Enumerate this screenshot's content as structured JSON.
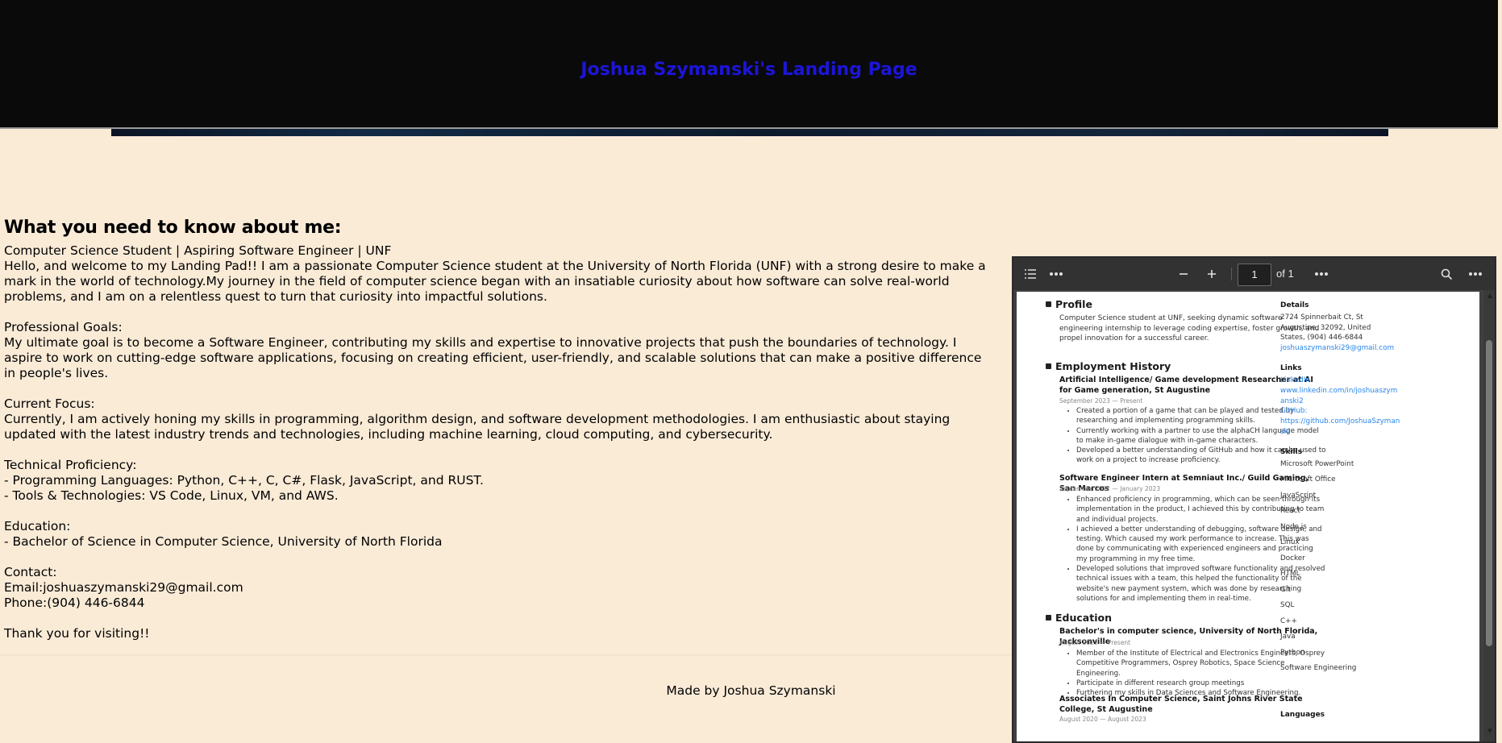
{
  "header": {
    "title": "Joshua Szymanski's Landing Page"
  },
  "about": {
    "heading": "What you need to know about me:",
    "subtitle": "Computer Science Student | Aspiring Software Engineer | UNF",
    "intro": "Hello, and welcome to my Landing Pad!! I am a passionate Computer Science student at the University of North Florida (UNF) with a strong desire to make a mark in the world of technology.My journey in the field of computer science began with an insatiable curiosity about how software can solve real-world problems, and I am on a relentless quest to turn that curiosity into impactful solutions.",
    "goals_label": "Professional Goals:",
    "goals": "My ultimate goal is to become a Software Engineer, contributing my skills and expertise to innovative projects that push the boundaries of technology. I aspire to work on cutting-edge software applications, focusing on creating efficient, user-friendly, and scalable solutions that can make a positive difference in people's lives.",
    "focus_label": "Current Focus:",
    "focus": "Currently, I am actively honing my skills in programming, algorithm design, and software development methodologies. I am enthusiastic about staying updated with the latest industry trends and technologies, including machine learning, cloud computing, and cybersecurity.",
    "tech_label": "Technical Proficiency:",
    "tech_lang": "- Programming Languages: Python, C++, C, C#, Flask, JavaScript, and RUST.",
    "tech_tools": "- Tools & Technologies: VS Code, Linux, VM, and AWS.",
    "edu_label": "Education:",
    "edu": "- Bachelor of Science in Computer Science, University of North Florida",
    "contact_label": "Contact:",
    "email": "Email:joshuaszymanski29@gmail.com",
    "phone": "Phone:(904) 446-6844",
    "thanks": "Thank you for visiting!!"
  },
  "footer": {
    "text": "Made by Joshua Szymanski"
  },
  "pdf": {
    "page_value": "1",
    "page_of": "of 1",
    "icons": [
      "outline-icon",
      "more-icon",
      "zoom-out-icon",
      "zoom-in-icon",
      "more-icon",
      "search-icon",
      "more-icon"
    ],
    "profile": {
      "heading": "Profile",
      "text": "Computer Science student at UNF, seeking dynamic software engineering internship to leverage coding expertise, foster growth, and propel innovation for a successful career."
    },
    "employment": {
      "heading": "Employment History",
      "jobs": [
        {
          "title": "Artificial Intelligence/ Game development Researcher at AI for Game generation, St Augustine",
          "dates": "September 2023 — Present",
          "bullets": [
            "Created a portion of a game that can be played and tested by researching and implementing programming skills.",
            "Currently working with a partner to use the alphaCH language model to make in-game dialogue with in-game characters.",
            "Developed a better understanding of GitHub and how it can be used to work on a project to increase proficiency."
          ]
        },
        {
          "title": "Software Engineer Intern at Semniaut Inc./ Guild Gaming, San Marcos",
          "dates": "September 2022 — January 2023",
          "bullets": [
            "Enhanced proficiency in programming, which can be seen through its implementation in the product, I achieved this by contributing to team and individual projects.",
            "I achieved a better understanding of debugging, software design, and testing. Which caused my work performance to increase. This was done by communicating with experienced engineers and practicing my programming in my free time.",
            "Developed solutions that improved software functionality and resolved technical issues with a team, this helped the functionality of the website's new payment system, which was done by researching solutions for and implementing them in real-time."
          ]
        }
      ]
    },
    "education": {
      "heading": "Education",
      "schools": [
        {
          "title": "Bachelor's in computer science, University of North Florida, Jacksonville",
          "dates": "August 2023 — Present",
          "bullets": [
            "Member of the Institute of Electrical and Electronics Engineers, Osprey Competitive Programmers, Osprey Robotics, Space Science Engineering.",
            "Participate in different research group meetings",
            "Furthering my skills in Data Sciences and Software Engineering."
          ]
        },
        {
          "title": "Associates In Computer Science, Saint Johns River State College, St Augustine",
          "dates": "August 2020 — August 2023",
          "bullets": []
        }
      ]
    },
    "details": {
      "heading": "Details",
      "address": "2724 Spinnerbait Ct, St Augustine, 32092, United States, (904) 446-6844",
      "email": "joshuaszymanski29@gmail.com"
    },
    "links": {
      "heading": "Links",
      "linkedin_label": "LinkedIn:",
      "linkedin_url": "www.linkedin.com/in/joshuaszymanski2",
      "github_label": "GitHub:",
      "github_url": "https://github.com/JoshuaSzymanski"
    },
    "skills": {
      "heading": "Skills",
      "items": [
        "Microsoft PowerPoint",
        "Microsoft Office",
        "JavaScript",
        "React",
        "Node.js",
        "Linux",
        "Docker",
        "HTML",
        "Git",
        "SQL",
        "C++",
        "Java",
        "Python",
        "Software Engineering"
      ]
    },
    "languages_heading": "Languages"
  }
}
